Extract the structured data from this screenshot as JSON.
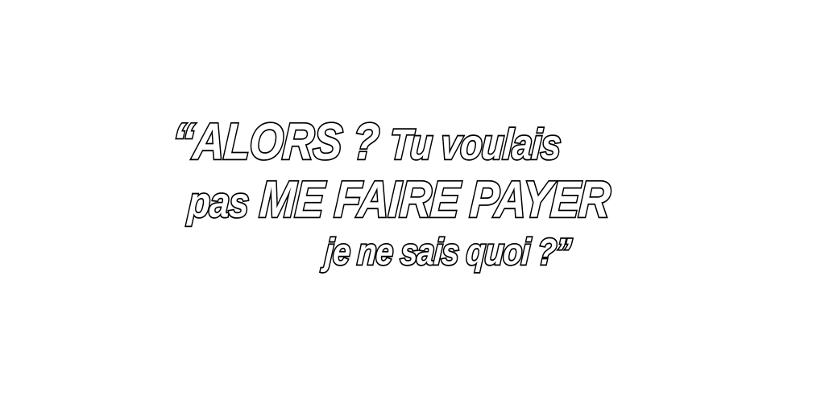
{
  "quote": {
    "line1": {
      "emphasis": "“ALORS ?",
      "rest": "Tu voulais"
    },
    "line2": {
      "lead": "pas",
      "emphasis": "ME FAIRE PAYER"
    },
    "line3": {
      "text": "je ne sais quoi ?”"
    }
  },
  "colors": {
    "text_fill": "#ffffff",
    "text_outline": "#000000",
    "background": "#ffffff"
  }
}
